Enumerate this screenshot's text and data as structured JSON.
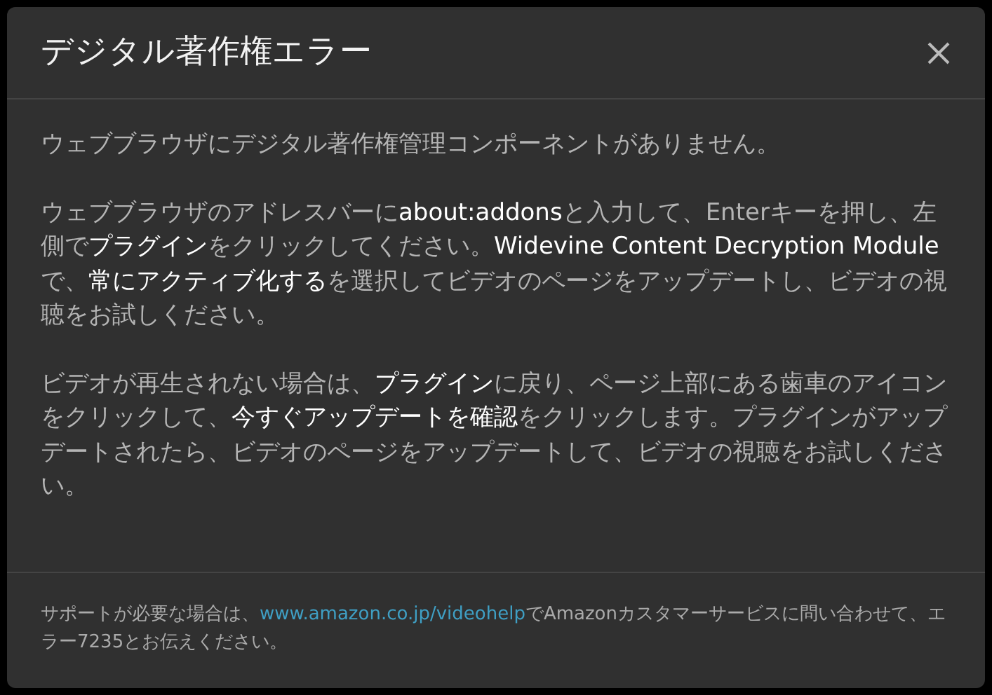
{
  "dialog": {
    "title": "デジタル著作権エラー",
    "paragraphs": [
      "ウェブブラウザにデジタル著作権管理コンポーネントがありません。",
      "ウェブブラウザのアドレスバーに**about:addons**と入力して、Enterキーを押し、左側で**プラグイン**をクリックしてください。**Widevine Content Decryption Module**で、**常にアクティブ化する**を選択してビデオのページをアップデートし、ビデオの視聴をお試しください。",
      "ビデオが再生されない場合は、**プラグイン**に戻り、ページ上部にある歯車のアイコンをクリックして、**今すぐアップデートを確認**をクリックします。プラグインがアップデートされたら、ビデオのページをアップデートして、ビデオの視聴をお試しください。"
    ],
    "footer": {
      "before": "サポートが必要な場合は、",
      "link": "www.amazon.co.jp/videohelp",
      "after": "でAmazonカスタマーサービスに問い合わせて、エラー7235とお伝えください。"
    }
  }
}
